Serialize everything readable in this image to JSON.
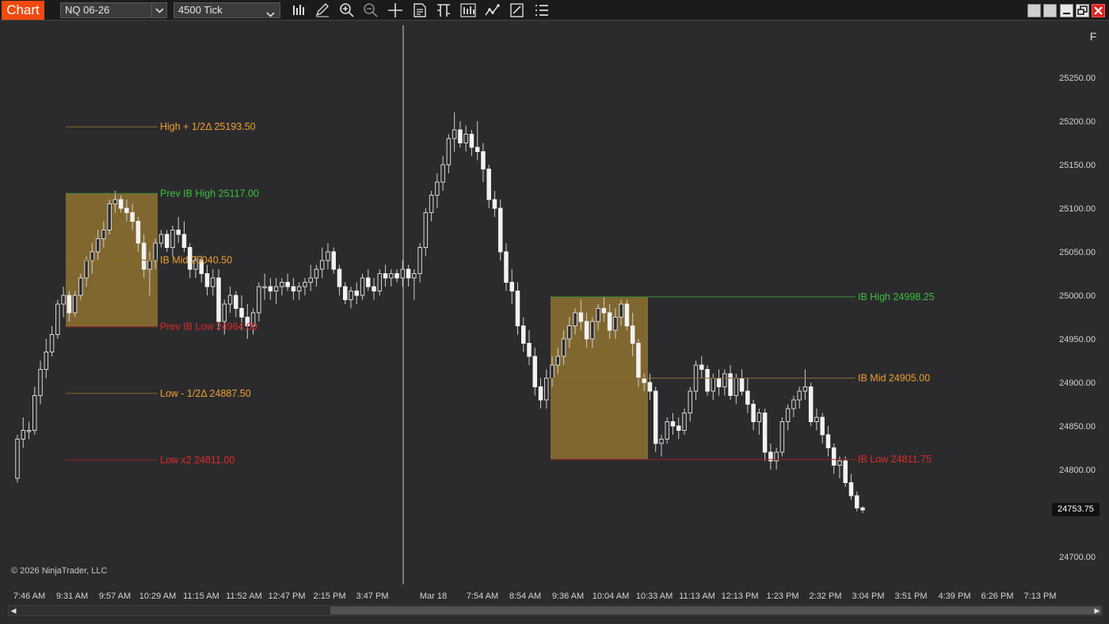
{
  "window": {
    "tab_label": "Chart",
    "panel_button_label": "F"
  },
  "toolbar": {
    "instrument": "NQ 06-26",
    "interval": "4500 Tick",
    "tools": [
      "bar-type-icon",
      "pencil-icon",
      "zoom-in-icon",
      "zoom-out-icon",
      "crosshair-icon",
      "data-box-icon",
      "chart-style-icon",
      "indicators-icon",
      "strategies-icon",
      "properties-icon",
      "menu-list-icon"
    ]
  },
  "price_axis": {
    "ticks": [
      "25250.00",
      "25200.00",
      "25150.00",
      "25100.00",
      "25050.00",
      "25000.00",
      "24950.00",
      "24900.00",
      "24850.00",
      "24800.00",
      "24700.00"
    ],
    "current_price": "24753.75"
  },
  "time_axis": {
    "ticks": [
      "7:46 AM",
      "9:31 AM",
      "9:57 AM",
      "10:29 AM",
      "11:15 AM",
      "11:52 AM",
      "12:47 PM",
      "2:15 PM",
      "3:47 PM",
      "Mar 18",
      "7:54 AM",
      "8:54 AM",
      "9:36 AM",
      "10:04 AM",
      "10:33 AM",
      "11:13 AM",
      "12:13 PM",
      "1:23 PM",
      "2:32 PM",
      "3:04 PM",
      "3:51 PM",
      "4:39 PM",
      "6:26 PM",
      "7:13 PM"
    ]
  },
  "levels": [
    {
      "label": "High + 1/2Δ 25193.50",
      "price": 25193.5,
      "color": "#f0a030",
      "line": "#8a6a2a"
    },
    {
      "label": "Prev IB High 25117.00",
      "price": 25117.0,
      "color": "#3cc03c",
      "line": "#3a8a3a"
    },
    {
      "label": "IB Mid 25040.50",
      "price": 25040.5,
      "color": "#f0a030",
      "line": "#8a6a2a"
    },
    {
      "label": "Prev IB Low 24964.00",
      "price": 24964.0,
      "color": "#e02828",
      "line": "#a02020"
    },
    {
      "label": "Low - 1/2Δ 24887.50",
      "price": 24887.5,
      "color": "#f0a030",
      "line": "#8a6a2a"
    },
    {
      "label": "Low x2 24811.00",
      "price": 24811.0,
      "color": "#e02828",
      "line": "#a02020"
    },
    {
      "label": "IB High 24998.25",
      "price": 24998.25,
      "color": "#3cc03c",
      "line": "#3a8a3a"
    },
    {
      "label": "IB Mid 24905.00",
      "price": 24905.0,
      "color": "#f0a030",
      "line": "#8a6a2a"
    },
    {
      "label": "IB Low 24811.75",
      "price": 24811.75,
      "color": "#e02828",
      "line": "#a02020"
    }
  ],
  "copyright": "© 2026 NinjaTrader, LLC",
  "chart_data": {
    "type": "candlestick",
    "instrument": "NQ 06-26",
    "interval": "4500 Tick",
    "ylim": [
      24675,
      25300
    ],
    "ib_boxes": [
      {
        "name": "Prev IB",
        "high": 25117.0,
        "low": 24964.0,
        "color": "#b48c32"
      },
      {
        "name": "IB",
        "high": 24998.25,
        "low": 24811.75,
        "color": "#b48c32"
      }
    ],
    "candles": [
      [
        24790,
        24840,
        24785,
        24835
      ],
      [
        24835,
        24860,
        24825,
        24845
      ],
      [
        24845,
        24855,
        24835,
        24845
      ],
      [
        24845,
        24895,
        24840,
        24885
      ],
      [
        24885,
        24925,
        24875,
        24915
      ],
      [
        24915,
        24950,
        24905,
        24935
      ],
      [
        24935,
        24965,
        24930,
        24955
      ],
      [
        24955,
        24995,
        24950,
        24990
      ],
      [
        24990,
        25010,
        24975,
        25000
      ],
      [
        25000,
        25005,
        24970,
        24980
      ],
      [
        24980,
        25005,
        24975,
        25000
      ],
      [
        25000,
        25025,
        24995,
        25020
      ],
      [
        25020,
        25045,
        25010,
        25040
      ],
      [
        25040,
        25060,
        25025,
        25050
      ],
      [
        25050,
        25075,
        25040,
        25065
      ],
      [
        25065,
        25085,
        25055,
        25075
      ],
      [
        25075,
        25110,
        25070,
        25105
      ],
      [
        25105,
        25120,
        25095,
        25110
      ],
      [
        25110,
        25115,
        25095,
        25100
      ],
      [
        25100,
        25110,
        25085,
        25095
      ],
      [
        25095,
        25105,
        25075,
        25085
      ],
      [
        25085,
        25090,
        25050,
        25060
      ],
      [
        25060,
        25070,
        25020,
        25030
      ],
      [
        25030,
        25050,
        25000,
        25040
      ],
      [
        25040,
        25065,
        25030,
        25060
      ],
      [
        25060,
        25075,
        25055,
        25070
      ],
      [
        25070,
        25075,
        25050,
        25055
      ],
      [
        25055,
        25080,
        25045,
        25075
      ],
      [
        25075,
        25090,
        25060,
        25070
      ],
      [
        25070,
        25085,
        25050,
        25055
      ],
      [
        25055,
        25060,
        25020,
        25030
      ],
      [
        25030,
        25045,
        25020,
        25040
      ],
      [
        25040,
        25045,
        25015,
        25025
      ],
      [
        25025,
        25035,
        25000,
        25010
      ],
      [
        25010,
        25030,
        25000,
        25020
      ],
      [
        25020,
        25030,
        24960,
        24970
      ],
      [
        24970,
        24995,
        24955,
        24990
      ],
      [
        24990,
        25010,
        24980,
        25000
      ],
      [
        25000,
        25005,
        24975,
        24985
      ],
      [
        24985,
        25000,
        24960,
        24975
      ],
      [
        24975,
        24990,
        24950,
        24965
      ],
      [
        24965,
        24985,
        24955,
        24980
      ],
      [
        24980,
        25015,
        24970,
        25010
      ],
      [
        25010,
        25025,
        24995,
        25010
      ],
      [
        25010,
        25020,
        24995,
        25005
      ],
      [
        25005,
        25020,
        24990,
        25010
      ],
      [
        25010,
        25020,
        25000,
        25015
      ],
      [
        25015,
        25025,
        25005,
        25010
      ],
      [
        25010,
        25020,
        24995,
        25005
      ],
      [
        25005,
        25015,
        24995,
        25010
      ],
      [
        25010,
        25020,
        25000,
        25015
      ],
      [
        25015,
        25035,
        25005,
        25020
      ],
      [
        25020,
        25035,
        25010,
        25030
      ],
      [
        25030,
        25055,
        25020,
        25040
      ],
      [
        25040,
        25060,
        25030,
        25050
      ],
      [
        25050,
        25055,
        25025,
        25030
      ],
      [
        25030,
        25035,
        25000,
        25010
      ],
      [
        25010,
        25015,
        24990,
        24995
      ],
      [
        24995,
        25010,
        24985,
        25005
      ],
      [
        25005,
        25015,
        24990,
        25000
      ],
      [
        25000,
        25025,
        24995,
        25020
      ],
      [
        25020,
        25030,
        25005,
        25010
      ],
      [
        25010,
        25020,
        24995,
        25005
      ],
      [
        25005,
        25030,
        25000,
        25025
      ],
      [
        25025,
        25035,
        25010,
        25020
      ],
      [
        25020,
        25030,
        25010,
        25025
      ],
      [
        25025,
        25030,
        25015,
        25020
      ],
      [
        25020,
        25040,
        25010,
        25030
      ],
      [
        25030,
        25035,
        25010,
        25020
      ],
      [
        25020,
        25030,
        24995,
        25025
      ],
      [
        25025,
        25060,
        25015,
        25055
      ],
      [
        25055,
        25100,
        25045,
        25095
      ],
      [
        25095,
        25120,
        25085,
        25115
      ],
      [
        25115,
        25140,
        25100,
        25130
      ],
      [
        25130,
        25160,
        25120,
        25150
      ],
      [
        25150,
        25185,
        25140,
        25180
      ],
      [
        25180,
        25210,
        25165,
        25190
      ],
      [
        25190,
        25200,
        25170,
        25175
      ],
      [
        25175,
        25195,
        25165,
        25185
      ],
      [
        25185,
        25190,
        25160,
        25170
      ],
      [
        25170,
        25200,
        25155,
        25165
      ],
      [
        25165,
        25175,
        25130,
        25145
      ],
      [
        25145,
        25150,
        25100,
        25110
      ],
      [
        25110,
        25120,
        25090,
        25100
      ],
      [
        25100,
        25110,
        25040,
        25050
      ],
      [
        25050,
        25060,
        25005,
        25015
      ],
      [
        25015,
        25030,
        24990,
        25005
      ],
      [
        25005,
        25015,
        24955,
        24965
      ],
      [
        24965,
        24975,
        24935,
        24945
      ],
      [
        24945,
        24960,
        24920,
        24930
      ],
      [
        24930,
        24940,
        24885,
        24895
      ],
      [
        24895,
        24905,
        24870,
        24880
      ],
      [
        24880,
        24915,
        24870,
        24905
      ],
      [
        24905,
        24930,
        24895,
        24920
      ],
      [
        24920,
        24940,
        24910,
        24930
      ],
      [
        24930,
        24960,
        24920,
        24950
      ],
      [
        24950,
        24975,
        24940,
        24965
      ],
      [
        24965,
        24985,
        24955,
        24980
      ],
      [
        24980,
        24995,
        24960,
        24970
      ],
      [
        24970,
        24980,
        24940,
        24950
      ],
      [
        24950,
        24975,
        24940,
        24970
      ],
      [
        24970,
        24990,
        24960,
        24985
      ],
      [
        24985,
        24998,
        24970,
        24980
      ],
      [
        24980,
        24990,
        24950,
        24960
      ],
      [
        24960,
        24985,
        24950,
        24975
      ],
      [
        24975,
        24995,
        24965,
        24990
      ],
      [
        24990,
        24995,
        24960,
        24965
      ],
      [
        24965,
        24980,
        24930,
        24945
      ],
      [
        24945,
        24950,
        24895,
        24905
      ],
      [
        24905,
        24910,
        24890,
        24900
      ],
      [
        24900,
        24910,
        24880,
        24890
      ],
      [
        24890,
        24895,
        24820,
        24830
      ],
      [
        24830,
        24840,
        24815,
        24835
      ],
      [
        24835,
        24860,
        24830,
        24855
      ],
      [
        24855,
        24865,
        24840,
        24850
      ],
      [
        24850,
        24860,
        24835,
        24845
      ],
      [
        24845,
        24870,
        24840,
        24865
      ],
      [
        24865,
        24895,
        24855,
        24890
      ],
      [
        24890,
        24925,
        24880,
        24920
      ],
      [
        24920,
        24930,
        24905,
        24915
      ],
      [
        24915,
        24920,
        24885,
        24890
      ],
      [
        24890,
        24910,
        24880,
        24905
      ],
      [
        24905,
        24915,
        24885,
        24895
      ],
      [
        24895,
        24915,
        24885,
        24910
      ],
      [
        24910,
        24920,
        24880,
        24885
      ],
      [
        24885,
        24910,
        24875,
        24905
      ],
      [
        24905,
        24915,
        24885,
        24890
      ],
      [
        24890,
        24905,
        24865,
        24875
      ],
      [
        24875,
        24880,
        24845,
        24855
      ],
      [
        24855,
        24870,
        24840,
        24865
      ],
      [
        24865,
        24870,
        24810,
        24820
      ],
      [
        24820,
        24830,
        24800,
        24810
      ],
      [
        24810,
        24825,
        24800,
        24820
      ],
      [
        24820,
        24860,
        24815,
        24855
      ],
      [
        24855,
        24875,
        24845,
        24870
      ],
      [
        24870,
        24885,
        24860,
        24880
      ],
      [
        24880,
        24895,
        24870,
        24890
      ],
      [
        24890,
        24915,
        24880,
        24895
      ],
      [
        24895,
        24900,
        24850,
        24855
      ],
      [
        24855,
        24870,
        24845,
        24860
      ],
      [
        24860,
        24865,
        24830,
        24840
      ],
      [
        24840,
        24850,
        24815,
        24825
      ],
      [
        24825,
        24830,
        24795,
        24805
      ],
      [
        24805,
        24815,
        24790,
        24810
      ],
      [
        24810,
        24815,
        24780,
        24785
      ],
      [
        24785,
        24795,
        24765,
        24770
      ],
      [
        24770,
        24775,
        24752,
        24756
      ],
      [
        24756,
        24758,
        24750,
        24753.75
      ]
    ]
  }
}
